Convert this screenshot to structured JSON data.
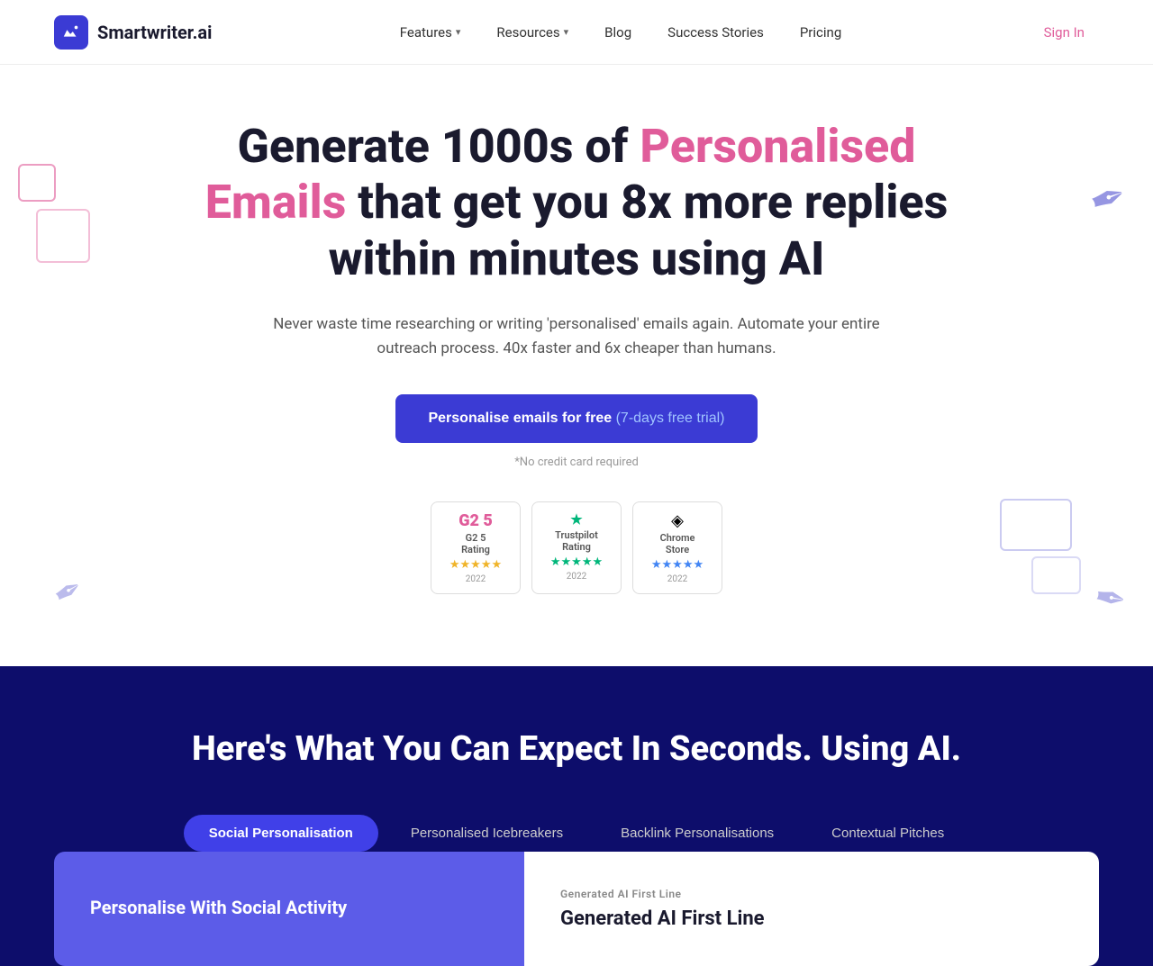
{
  "nav": {
    "logo_text": "Smartwriter.ai",
    "links": [
      {
        "label": "Features",
        "has_dropdown": true
      },
      {
        "label": "Resources",
        "has_dropdown": true
      },
      {
        "label": "Blog",
        "has_dropdown": false
      },
      {
        "label": "Success Stories",
        "has_dropdown": false
      },
      {
        "label": "Pricing",
        "has_dropdown": false
      }
    ],
    "signin_label": "Sign In"
  },
  "hero": {
    "title_before": "Generate 1000s of ",
    "title_highlight": "Personalised Emails",
    "title_after": " that get you 8x more replies within minutes using AI",
    "subtitle": "Never waste time researching or writing 'personalised' emails again. Automate your entire outreach process. 40x faster and 6x cheaper than humans.",
    "cta_main": "Personalise emails for free",
    "cta_trial": " (7-days free trial)",
    "no_credit": "*No credit card required"
  },
  "ratings": [
    {
      "logo": "G2 5",
      "name": "G2 5\nRating",
      "stars": "★★★★★",
      "year": "2022",
      "type": "g2"
    },
    {
      "logo": "★",
      "name": "Trustpilot\nRating",
      "stars": "★★★★★",
      "year": "2022",
      "type": "trustpilot"
    },
    {
      "logo": "◈",
      "name": "Chrome\nStore",
      "stars": "★★★★★",
      "year": "2022",
      "type": "chrome"
    }
  ],
  "dark_section": {
    "title": "Here's What You Can Expect In Seconds. Using AI.",
    "tabs": [
      {
        "label": "Social Personalisation",
        "active": true
      },
      {
        "label": "Personalised Icebreakers",
        "active": false
      },
      {
        "label": "Backlink Personalisations",
        "active": false
      },
      {
        "label": "Contextual Pitches",
        "active": false
      }
    ],
    "sub_left_label": "",
    "sub_left_title": "Personalise With Social Activity",
    "sub_right_label": "Generated AI First Line",
    "sub_right_title": "Generated AI First Line"
  }
}
